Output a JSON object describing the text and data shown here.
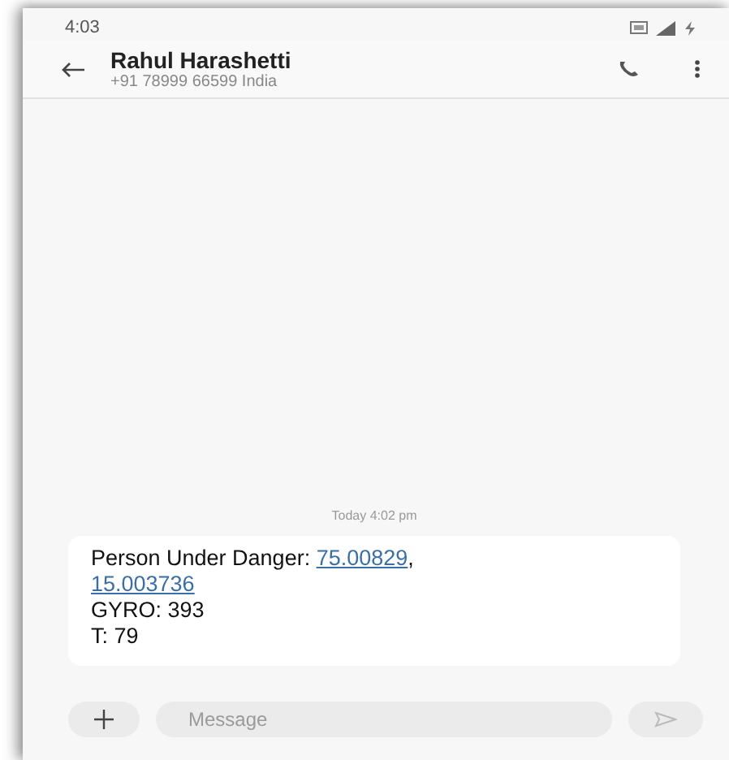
{
  "status_bar": {
    "time": "4:03"
  },
  "header": {
    "name": "Rahul Harashetti",
    "subtitle": "+91 78999 66599  India"
  },
  "timestamp": "Today 4:02 pm",
  "message": {
    "lines": [
      [
        {
          "kind": "text",
          "text": "Person Under Danger: "
        },
        {
          "kind": "link",
          "text": "75.00829"
        },
        {
          "kind": "text",
          "text": ","
        }
      ],
      [
        {
          "kind": "link",
          "text": "15.003736"
        }
      ],
      [
        {
          "kind": "text",
          "text": "GYRO: 393"
        }
      ],
      [
        {
          "kind": "text",
          "text": "T: 79"
        }
      ]
    ]
  },
  "composer": {
    "placeholder": "Message"
  }
}
